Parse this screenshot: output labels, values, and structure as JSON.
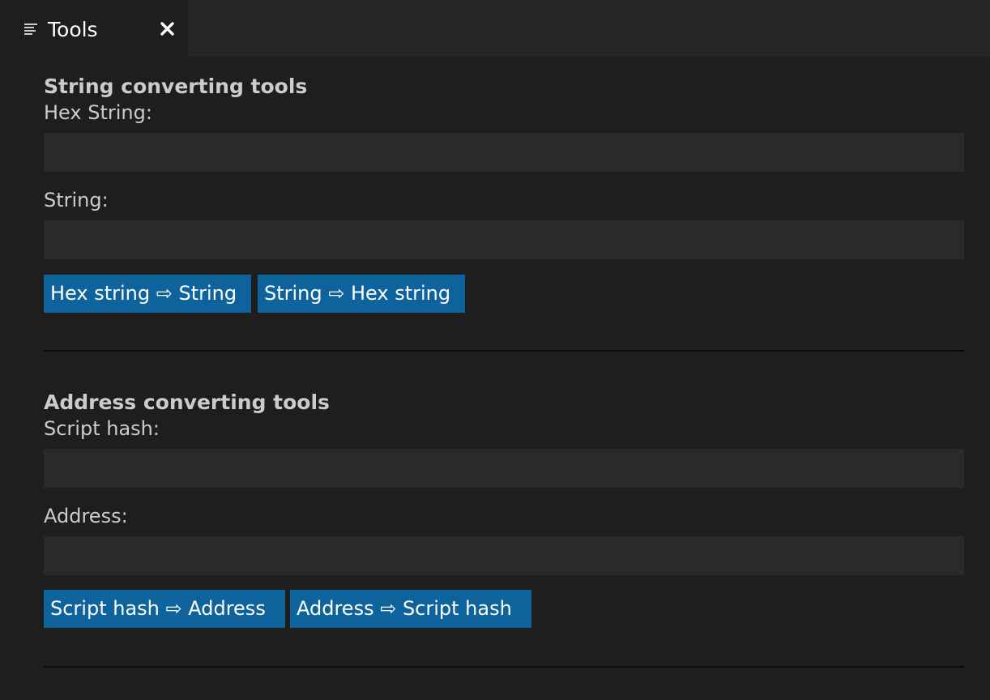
{
  "tab": {
    "title": "Tools",
    "icon": "list-icon",
    "close_glyph": "✕"
  },
  "string_tools": {
    "title": "String converting tools",
    "hex_label": "Hex String:",
    "hex_value": "",
    "string_label": "String:",
    "string_value": "",
    "hex_to_string_button": "Hex string ⇨ String",
    "string_to_hex_button": "String ⇨ Hex string"
  },
  "address_tools": {
    "title": "Address converting tools",
    "script_hash_label": "Script hash:",
    "script_hash_value": "",
    "address_label": "Address:",
    "address_value": "",
    "script_hash_to_address_button": "Script hash ⇨ Address",
    "address_to_script_hash_button": "Address ⇨ Script hash"
  },
  "colors": {
    "background": "#1e1e1e",
    "tabbar": "#252526",
    "input_background": "#2a2a2a",
    "button": "#0e639c",
    "text": "#cccccc"
  }
}
